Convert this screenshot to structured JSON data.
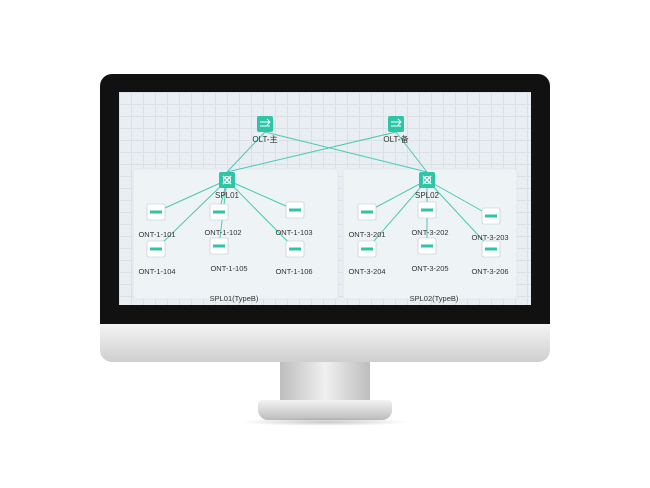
{
  "olts": [
    {
      "id": "olt-main",
      "label": "OLT-主"
    },
    {
      "id": "olt-backup",
      "label": "OLT-备"
    }
  ],
  "groups": [
    {
      "id": "g1",
      "caption": "SPL01(TypeB)",
      "splitter": "SPL01",
      "onts": [
        "ONT-1-101",
        "ONT-1-102",
        "ONT-1-103",
        "ONT-1-104",
        "ONT-1-105",
        "ONT-1-106"
      ]
    },
    {
      "id": "g2",
      "caption": "SPL02(TypeB)",
      "splitter": "SPL02",
      "onts": [
        "ONT-3-201",
        "ONT-3-202",
        "ONT-3-203",
        "ONT-3-204",
        "ONT-3-205",
        "ONT-3-206"
      ]
    }
  ],
  "colors": {
    "accent": "#2ec4a6",
    "link": "#49c9b1",
    "text": "#333333",
    "group_bg": "#eef3f6"
  }
}
